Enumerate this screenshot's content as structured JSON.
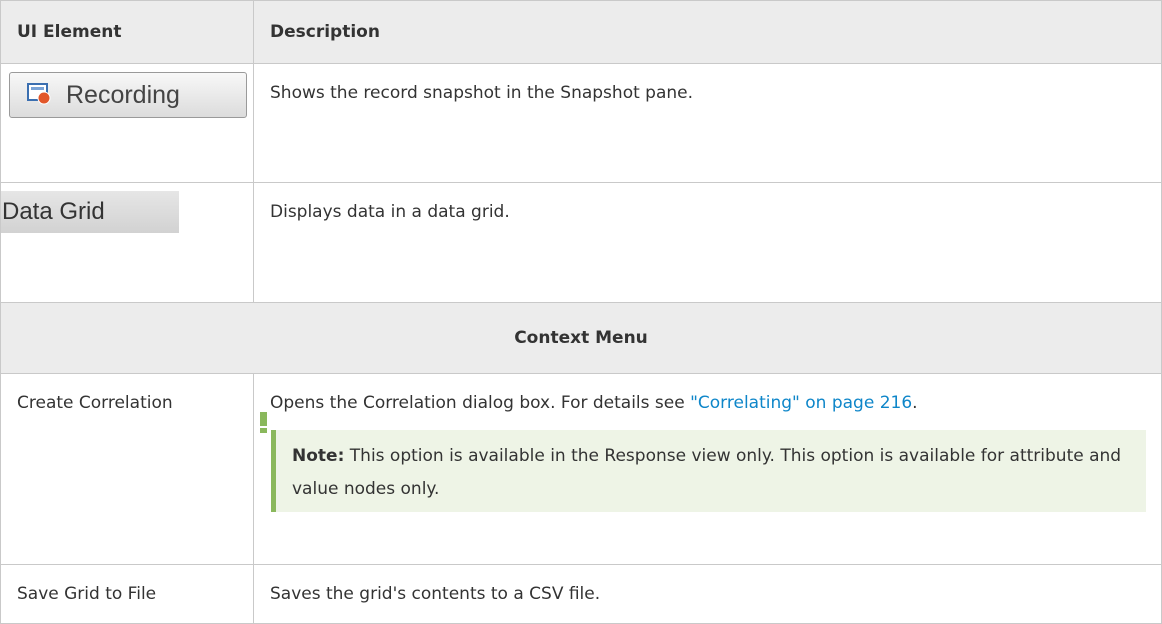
{
  "table": {
    "header": {
      "col1": "UI Element",
      "col2": "Description"
    },
    "rows": {
      "recording": {
        "button_label": "Recording",
        "button_icon": "recording-snapshot-icon",
        "description": "Shows the record snapshot in the Snapshot pane."
      },
      "data_grid": {
        "tab_label": "Data Grid",
        "description": "Displays data in a data grid."
      },
      "context_menu": {
        "label": "Context Menu"
      },
      "create_correlation": {
        "element": "Create Correlation",
        "description_prefix": "Opens the Correlation dialog box. For details see ",
        "link_text": "\"Correlating\" on page 216",
        "description_suffix": ".",
        "note_label": "Note:",
        "note_text": "This option is available in the Response view only. This option is available for attribute and value nodes only."
      },
      "save_grid": {
        "element": "Save Grid to File",
        "description": "Saves the grid's contents to a CSV file."
      }
    }
  },
  "colors": {
    "link": "#0e86c9",
    "note_accent": "#8ab85c",
    "note_bg": "#eef4e6",
    "header_bg": "#ececec"
  }
}
